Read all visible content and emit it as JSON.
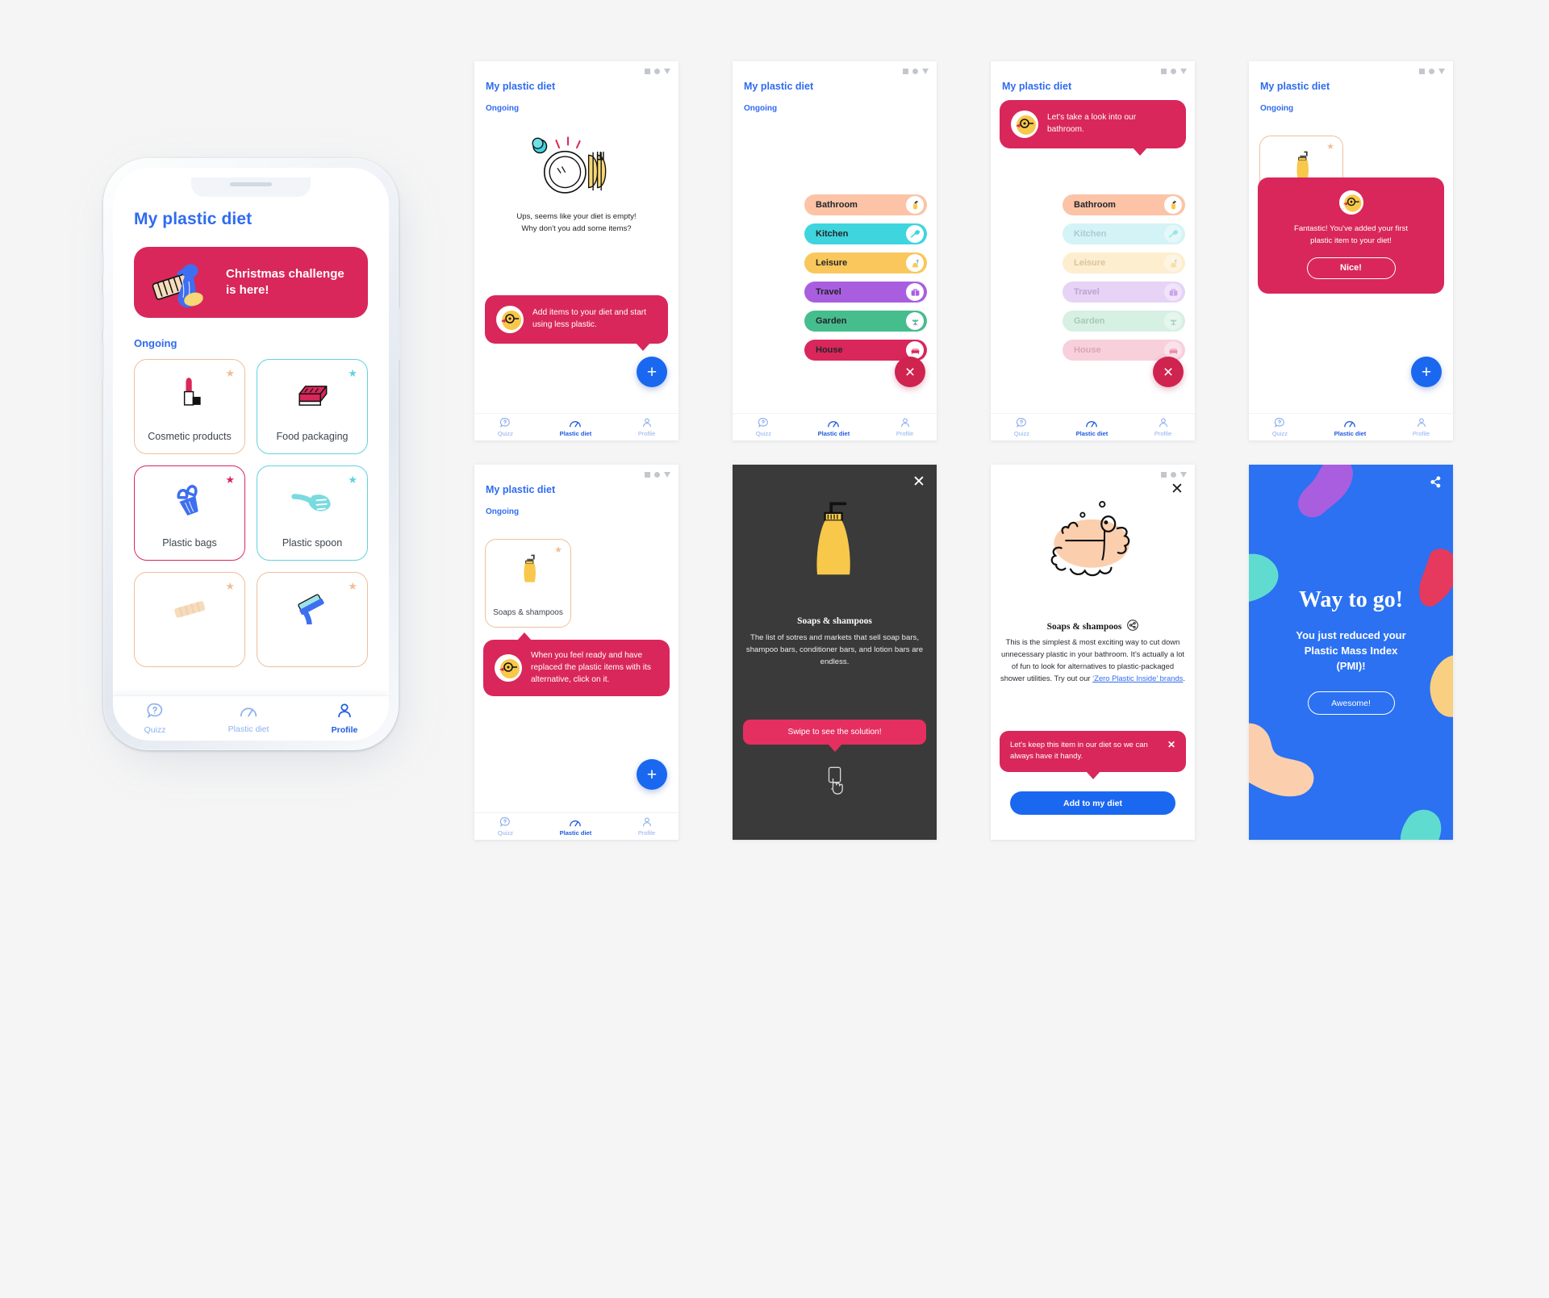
{
  "app": {
    "title": "My plastic diet",
    "section_ongoing": "Ongoing"
  },
  "phone": {
    "title": "My plastic diet",
    "banner_line1": "Christmas challenge",
    "banner_line2": "is here!",
    "section": "Ongoing",
    "cards": [
      {
        "label": "Cosmetic products",
        "color": "peach",
        "icon": "lipstick-icon"
      },
      {
        "label": "Food packaging",
        "color": "cyan",
        "icon": "food-tray-icon"
      },
      {
        "label": "Plastic bags",
        "color": "pink",
        "icon": "plastic-bag-icon"
      },
      {
        "label": "Plastic spoon",
        "color": "cyan",
        "icon": "spatula-icon"
      },
      {
        "label": "",
        "color": "peach",
        "icon": "comb-icon"
      },
      {
        "label": "",
        "color": "peach",
        "icon": "razor-icon"
      }
    ],
    "nav": [
      {
        "label": "Quizz",
        "icon": "question-bubble-icon",
        "active": false
      },
      {
        "label": "Plastic diet",
        "icon": "gauge-icon",
        "active": false
      },
      {
        "label": "Profile",
        "icon": "person-icon",
        "active": true
      }
    ]
  },
  "nav_small": [
    {
      "label": "Quizz",
      "icon": "question-bubble-icon",
      "active": false
    },
    {
      "label": "Plastic diet",
      "icon": "gauge-icon",
      "active": true
    },
    {
      "label": "Profile",
      "icon": "person-icon",
      "active": false
    }
  ],
  "screen1": {
    "title": "My plastic diet",
    "section": "Ongoing",
    "empty_line1": "Ups, seems like your diet is empty!",
    "empty_line2": "Why don't you add some items?",
    "tooltip": "Add items to your diet and start using less plastic.",
    "fab": "+"
  },
  "screen2": {
    "title": "My plastic diet",
    "section": "Ongoing",
    "categories": [
      {
        "label": "Bathroom",
        "color": "#fcc3a7",
        "icon": "soap-dispenser-icon"
      },
      {
        "label": "Kitchen",
        "color": "#3fd5de",
        "icon": "spatula-icon"
      },
      {
        "label": "Leisure",
        "color": "#f9c75b",
        "icon": "sandcastle-icon"
      },
      {
        "label": "Travel",
        "color": "#a95ee0",
        "icon": "suitcase-icon"
      },
      {
        "label": "Garden",
        "color": "#46bd8d",
        "icon": "plant-icon"
      },
      {
        "label": "House",
        "color": "#d9275b",
        "icon": "sofa-icon"
      }
    ],
    "fab": "×"
  },
  "screen3": {
    "title": "My plastic diet",
    "tooltip": "Let's take a look into our bathroom.",
    "categories": [
      {
        "label": "Bathroom",
        "color": "#fcc3a7",
        "icon": "soap-dispenser-icon",
        "dimmed": false
      },
      {
        "label": "Kitchen",
        "color": "#3fd5de",
        "icon": "spatula-icon",
        "dimmed": true
      },
      {
        "label": "Leisure",
        "color": "#f9c75b",
        "icon": "sandcastle-icon",
        "dimmed": true
      },
      {
        "label": "Travel",
        "color": "#a95ee0",
        "icon": "suitcase-icon",
        "dimmed": true
      },
      {
        "label": "Garden",
        "color": "#46bd8d",
        "icon": "plant-icon",
        "dimmed": true
      },
      {
        "label": "House",
        "color": "#d9275b",
        "icon": "sofa-icon",
        "dimmed": true
      }
    ],
    "fab": "×"
  },
  "screen4": {
    "title": "My plastic diet",
    "section": "Ongoing",
    "modal_line1": "Fantastic! You've added your first",
    "modal_line2": "plastic item to your diet!",
    "modal_button": "Nice!",
    "fab": "+"
  },
  "screen5": {
    "title": "My plastic diet",
    "section": "Ongoing",
    "card_label": "Soaps & shampoos",
    "tooltip": "When you feel ready and have replaced the plastic items with its alternative, click on it.",
    "fab": "+"
  },
  "screen6": {
    "heading": "Soaps & shampoos",
    "body": "The list of sotres and markets that sell soap bars, shampoo bars, conditioner bars, and lotion bars are endless.",
    "cta": "Swipe to see the solution!",
    "close": "✕",
    "swipe_icon": "swipe-hand-icon"
  },
  "screen7": {
    "heading": "Soaps & shampoos",
    "share_icon": "share-icon",
    "body_pre": "This is the simplest & most exciting way to cut down unnecessary plastic in your bathroom. It’s actually a lot of fun to look for alternatives to plastic-packaged shower utilities. Try out our ",
    "body_link": "‘Zero Plastic Inside’ brands",
    "body_post": ".",
    "toast": "Let's keep this item in our diet so we can always have it handy.",
    "toast_close": "✕",
    "cta": "Add to my diet",
    "close": "✕"
  },
  "screen8": {
    "heading": "Way to go!",
    "body_line1": "You just reduced your",
    "body_line2": "Plastic Mass Index",
    "body_line3": "(PMI)!",
    "cta": "Awesome!",
    "share_icon": "share-icon"
  },
  "colors": {
    "brand_blue": "#2f6bf0",
    "brand_pink": "#d9275b",
    "accent_cyan": "#3fd5de",
    "accent_peach": "#fcc3a7",
    "dark_bg": "#3a3a3a",
    "celebration_blue": "#2b71f2"
  }
}
